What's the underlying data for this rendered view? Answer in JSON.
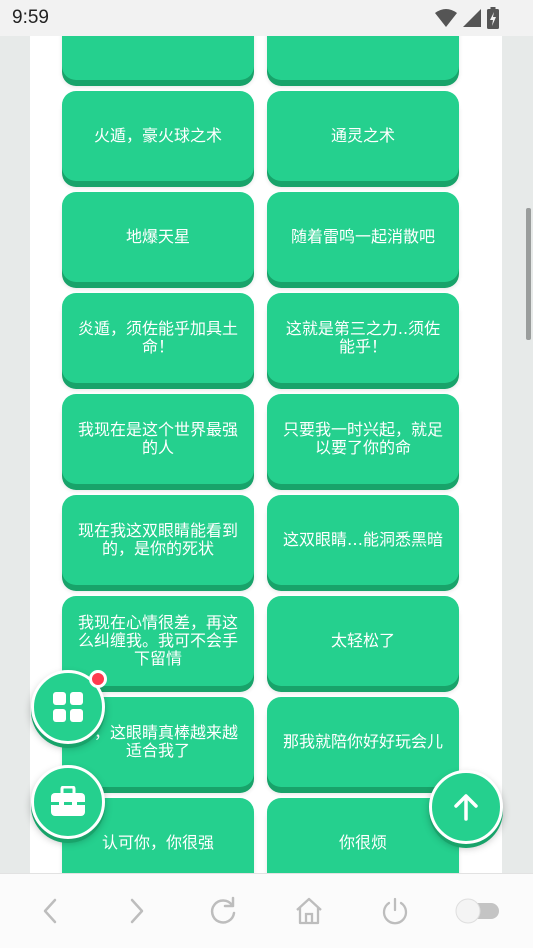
{
  "status_bar": {
    "time": "9:59"
  },
  "cards": [
    {
      "text": ""
    },
    {
      "text": ""
    },
    {
      "text": "火遁，豪火球之术"
    },
    {
      "text": "通灵之术"
    },
    {
      "text": "地爆天星"
    },
    {
      "text": "随着雷鸣一起消散吧"
    },
    {
      "text": "炎遁，须佐能乎加具土命！"
    },
    {
      "text": "这就是第三之力..须佐能乎！"
    },
    {
      "text": "我现在是这个世界最强的人"
    },
    {
      "text": "只要我一时兴起，就足以要了你的命"
    },
    {
      "text": "现在我这双眼睛能看到的，是你的死状"
    },
    {
      "text": "这双眼睛…能洞悉黑暗"
    },
    {
      "text": "我现在心情很差，再这么纠缠我。我可不会手下留情"
    },
    {
      "text": "太轻松了"
    },
    {
      "text": "哥，这眼睛真棒越来越适合我了"
    },
    {
      "text": "那我就陪你好好玩会儿"
    },
    {
      "text": "认可你，你很强"
    },
    {
      "text": "你很烦"
    }
  ],
  "icons": {
    "grid": "grid-icon",
    "toolbox": "toolbox-icon",
    "up": "arrow-up-icon",
    "back": "chevron-left-icon",
    "forward": "chevron-right-icon",
    "reload": "reload-icon",
    "home": "home-icon",
    "power": "power-icon",
    "toggle": "toggle-switch"
  },
  "colors": {
    "accent": "#25d08e",
    "accent_shadow": "#18a36a",
    "badge": "#ff3b4e"
  }
}
